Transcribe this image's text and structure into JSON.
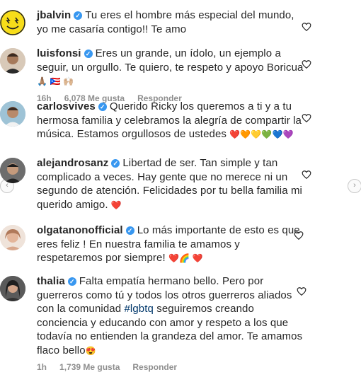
{
  "comments": [
    {
      "username": "jbalvin",
      "text": "Tu eres el hombre más especial del mundo, yo me casaría contigo!! Te amo",
      "emojis": ""
    },
    {
      "username": "luisfonsi",
      "text": "Eres un grande, un ídolo, un ejemplo a seguir, un orgullo. Te quiero, te respeto y apoyo Boricua",
      "emojis": "🙏🏽 🇵🇷 🙌🏼",
      "time": "16h",
      "likes": "6,078 Me gusta",
      "reply": "Responder"
    },
    {
      "username": "carlosvives",
      "text": "Querido Ricky los queremos a ti y a tu hermosa familia y celebramos la alegría de compartir la música. Estamos orgullosos de ustedes",
      "emojis": "❤️🧡💛💚💙💜"
    },
    {
      "username": "alejandrosanz",
      "text": "Libertad de ser. Tan simple y tan complicado a veces. Hay gente que no merece ni un segundo de atención. Felicidades por tu bella familia mi querido amigo.",
      "emojis": "❤️"
    },
    {
      "username": "olgatanonofficial",
      "text": "Lo más importante de esto es que eres feliz ! En nuestra familia te amamos y respetaremos por siempre!",
      "emojis": "❤️🌈 ❤️"
    },
    {
      "username": "thalia",
      "text_before": "Falta empatía hermano bello. Pero por guerreros como tú y todos los otros guerreros aliados con la comunidad",
      "hashtag": "#lgbtq",
      "text_after": "seguiremos creando conciencia y educando con amor y respeto a los que todavía no entienden la grandeza del amor. Te amamos flaco bello",
      "emojis": "😍",
      "time": "1h",
      "likes": "1,739 Me gusta",
      "reply": "Responder"
    }
  ],
  "colors": {
    "verified": "#3897f0",
    "meta": "#8e8e8e",
    "hashtag": "#00376b"
  }
}
